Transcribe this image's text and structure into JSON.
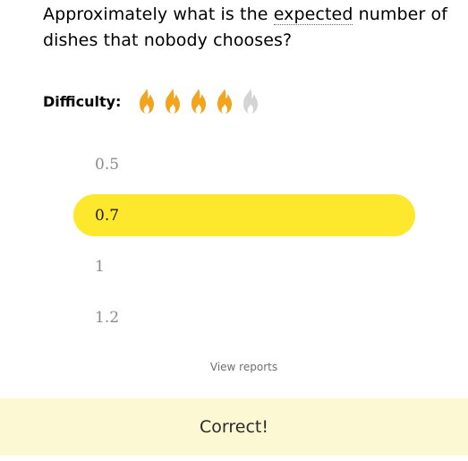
{
  "question": {
    "before": "Approximately what is the ",
    "term": "expected",
    "after": " number of dishes that nobody chooses?"
  },
  "difficulty": {
    "label": "Difficulty:",
    "level": 4,
    "max": 5,
    "flame_icon": "flame-icon",
    "active_color": "#f2a41f",
    "inactive_color": "#d4d4d4"
  },
  "answers": [
    {
      "label": "0.5",
      "selected": false
    },
    {
      "label": "0.7",
      "selected": true
    },
    {
      "label": "1",
      "selected": false
    },
    {
      "label": "1.2",
      "selected": false
    }
  ],
  "view_reports": "View reports",
  "result": {
    "text": "Correct!",
    "background": "#fdf8d4"
  },
  "selected_color": "#fee82d"
}
